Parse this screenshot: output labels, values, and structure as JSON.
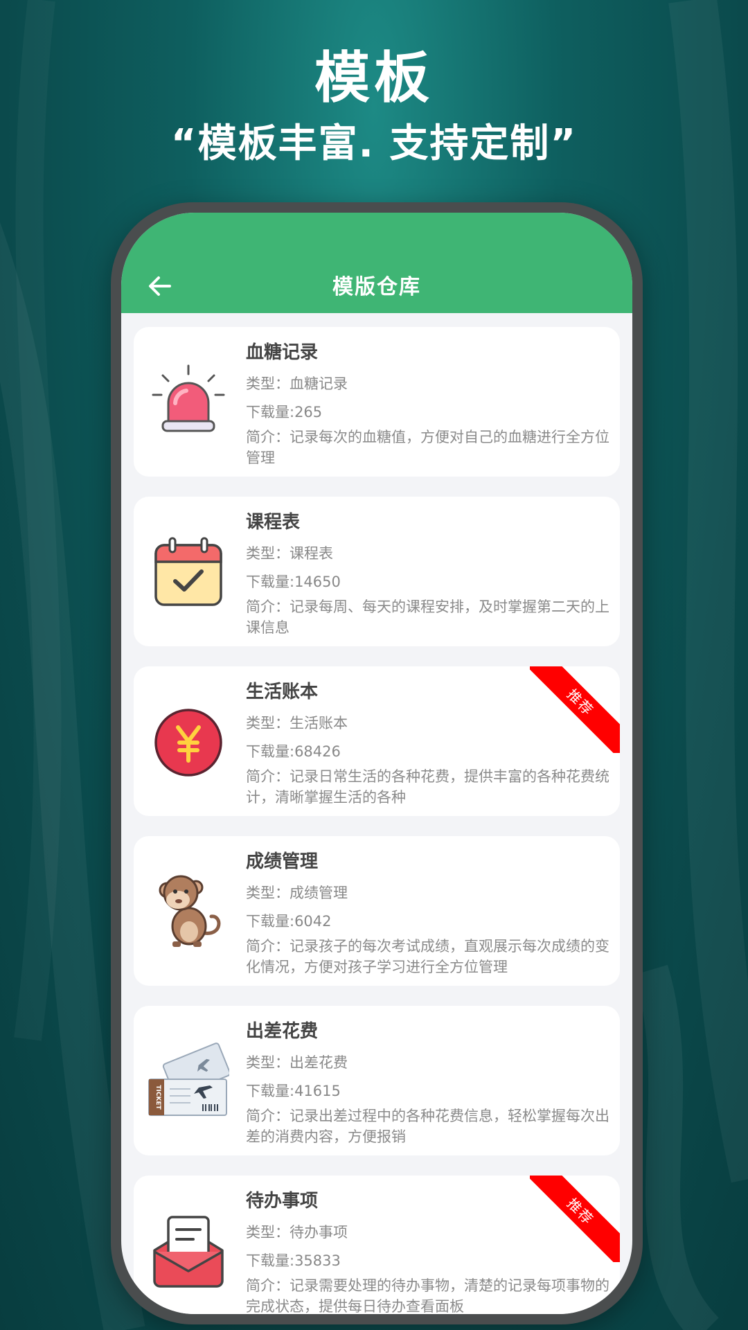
{
  "promo": {
    "headline": "模板",
    "subline": "“模板丰富. 支持定制”"
  },
  "appbar": {
    "back_icon": "arrow-left-icon",
    "title": "模版仓库",
    "color": "#3fb574"
  },
  "templates": [
    {
      "title": "血糖记录",
      "type": "类型：血糖记录",
      "downloads": "下载量:265",
      "desc": "简介：记录每次的血糖值，方便对自己的血糖进行全方位管理",
      "icon": "alarm-siren-icon",
      "badge": ""
    },
    {
      "title": "课程表",
      "type": "类型：课程表",
      "downloads": "下载量:14650",
      "desc": "简介：记录每周、每天的课程安排，及时掌握第二天的上课信息",
      "icon": "calendar-check-icon",
      "badge": ""
    },
    {
      "title": "生活账本",
      "type": "类型：生活账本",
      "downloads": "下载量:68426",
      "desc": "简介：记录日常生活的各种花费，提供丰富的各种花费统计，清晰掌握生活的各种",
      "icon": "yen-coin-icon",
      "badge": "推荐"
    },
    {
      "title": "成绩管理",
      "type": "类型：成绩管理",
      "downloads": "下载量:6042",
      "desc": "简介：记录孩子的每次考试成绩，直观展示每次成绩的变化情况，方便对孩子学习进行全方位管理",
      "icon": "monkey-icon",
      "badge": ""
    },
    {
      "title": "出差花费",
      "type": "类型：出差花费",
      "downloads": "下载量:41615",
      "desc": "简介：记录出差过程中的各种花费信息，轻松掌握每次出差的消费内容，方便报销",
      "icon": "plane-ticket-icon",
      "badge": ""
    },
    {
      "title": "待办事项",
      "type": "类型：待办事项",
      "downloads": "下载量:35833",
      "desc": "简介：记录需要处理的待办事物，清楚的记录每项事物的完成状态，提供每日待办查看面板",
      "icon": "envelope-letter-icon",
      "badge": "推荐"
    }
  ],
  "ticket_text": "TICKET"
}
